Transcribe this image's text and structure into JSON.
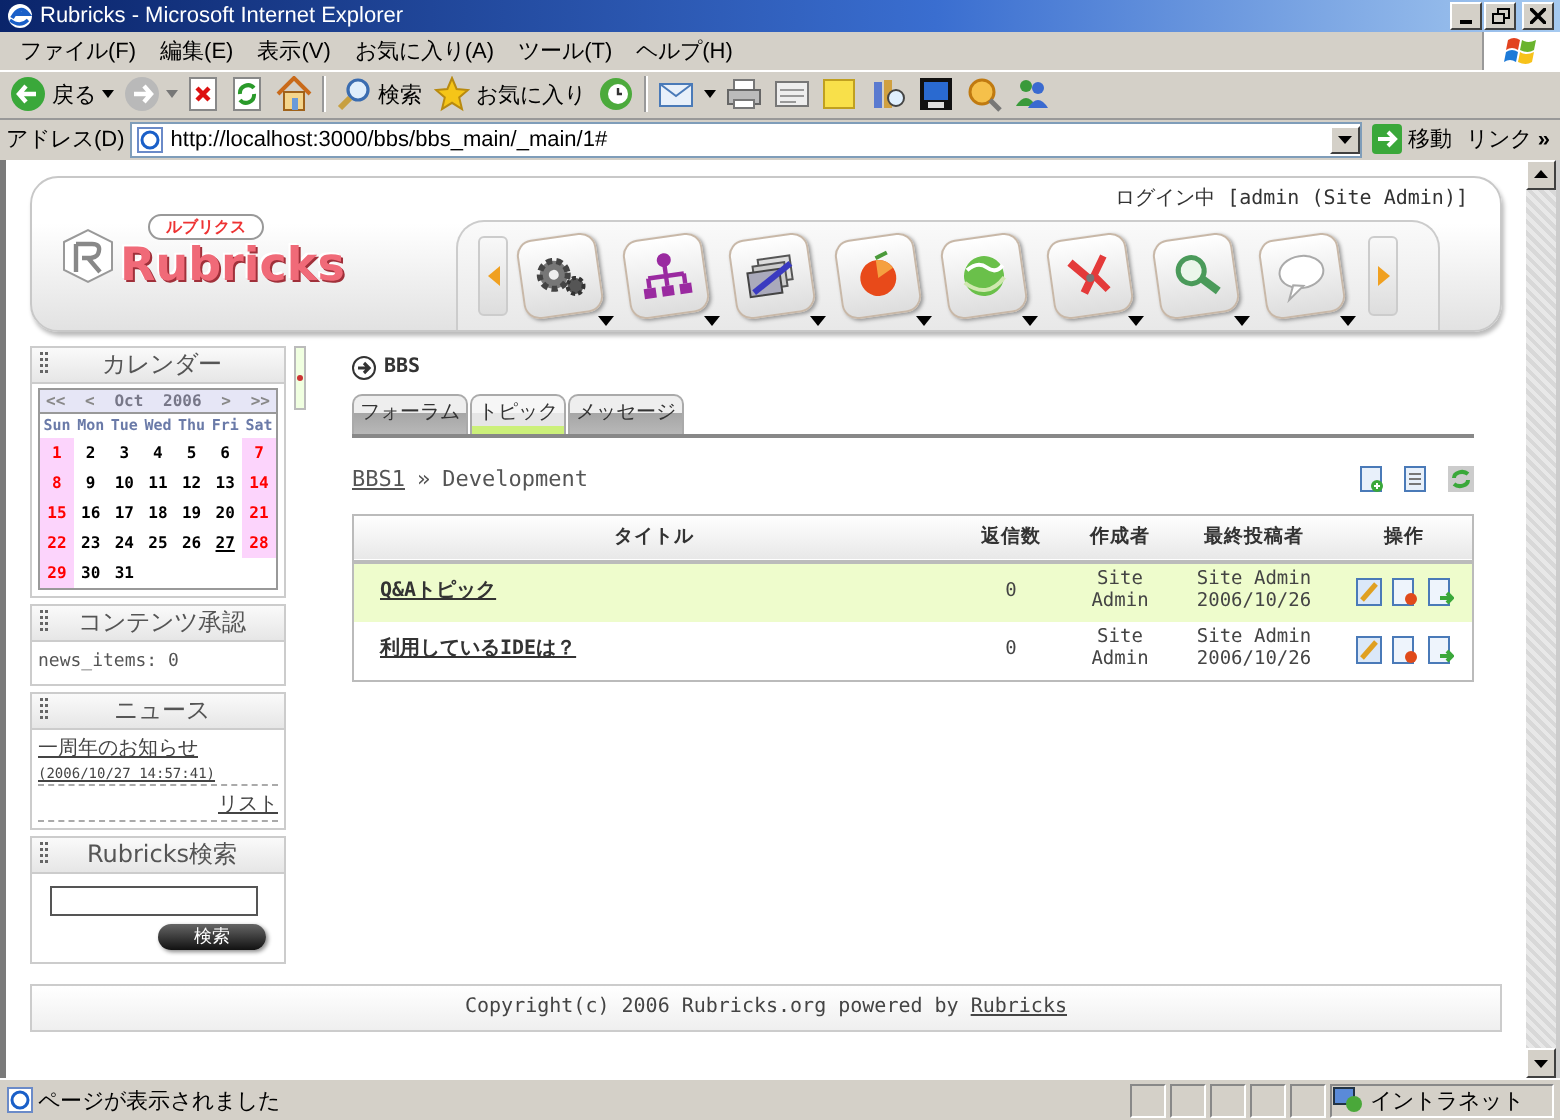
{
  "window": {
    "title": "Rubricks - Microsoft Internet Explorer"
  },
  "menu": [
    "ファイル(F)",
    "編集(E)",
    "表示(V)",
    "お気に入り(A)",
    "ツール(T)",
    "ヘルプ(H)"
  ],
  "toolbar": {
    "back": "戻る",
    "search": "検索",
    "favorites": "お気に入り"
  },
  "address": {
    "label": "アドレス(D)",
    "url": "http://localhost:3000/bbs/bbs_main/_main/1#",
    "go": "移動",
    "links": "リンク",
    "links_more": "»"
  },
  "header": {
    "logo_kana": "ルブリクス",
    "logo": "Rubricks",
    "login": "ログイン中 [admin (Site Admin)]"
  },
  "calendar": {
    "title": "カレンダー",
    "nav": [
      "<<",
      "<",
      "Oct",
      "2006",
      ">",
      ">>"
    ],
    "weekdays": [
      {
        "label": "Sun",
        "weekend": true
      },
      {
        "label": "Mon",
        "weekend": false
      },
      {
        "label": "Tue",
        "weekend": false
      },
      {
        "label": "Wed",
        "weekend": false
      },
      {
        "label": "Thu",
        "weekend": false
      },
      {
        "label": "Fri",
        "weekend": false
      },
      {
        "label": "Sat",
        "weekend": true
      }
    ],
    "weeks": [
      [
        {
          "day": "1",
          "link": false
        },
        {
          "day": "2",
          "link": false
        },
        {
          "day": "3",
          "link": false
        },
        {
          "day": "4",
          "link": false
        },
        {
          "day": "5",
          "link": false
        },
        {
          "day": "6",
          "link": false
        },
        {
          "day": "7",
          "link": false
        }
      ],
      [
        {
          "day": "8",
          "link": false
        },
        {
          "day": "9",
          "link": false
        },
        {
          "day": "10",
          "link": false
        },
        {
          "day": "11",
          "link": false
        },
        {
          "day": "12",
          "link": false
        },
        {
          "day": "13",
          "link": false
        },
        {
          "day": "14",
          "link": false
        }
      ],
      [
        {
          "day": "15",
          "link": false
        },
        {
          "day": "16",
          "link": false
        },
        {
          "day": "17",
          "link": false
        },
        {
          "day": "18",
          "link": false
        },
        {
          "day": "19",
          "link": false
        },
        {
          "day": "20",
          "link": false
        },
        {
          "day": "21",
          "link": false
        }
      ],
      [
        {
          "day": "22",
          "link": false
        },
        {
          "day": "23",
          "link": false
        },
        {
          "day": "24",
          "link": false
        },
        {
          "day": "25",
          "link": false
        },
        {
          "day": "26",
          "link": false
        },
        {
          "day": "27",
          "link": true
        },
        {
          "day": "28",
          "link": false
        }
      ],
      [
        {
          "day": "29",
          "link": false
        },
        {
          "day": "30",
          "link": false
        },
        {
          "day": "31",
          "link": false
        }
      ]
    ]
  },
  "approval": {
    "title": "コンテンツ承認",
    "text": "news_items: 0"
  },
  "news": {
    "title": "ニュース",
    "items": [
      {
        "title": "一周年のお知らせ",
        "date": "(2006/10/27 14:57:41)"
      }
    ],
    "more": "リスト"
  },
  "site_search": {
    "title": "Rubricks検索",
    "button": "検索"
  },
  "main": {
    "heading": "BBS",
    "tabs": [
      {
        "label": "フォーラム",
        "selected": false
      },
      {
        "label": "トピック",
        "selected": true
      },
      {
        "label": "メッセージ",
        "selected": false
      }
    ],
    "breadcrumb": {
      "link": "BBS1",
      "separator": "»",
      "current": "Development"
    },
    "columns": [
      "タイトル",
      "返信数",
      "作成者",
      "最終投稿者",
      "操作"
    ],
    "rows": [
      {
        "title": "Q&Aトピック",
        "replies": "0",
        "author": "Site Admin",
        "last_poster": "Site Admin",
        "last_date": "2006/10/26",
        "selected": true
      },
      {
        "title": "利用しているIDEは？",
        "replies": "0",
        "author": "Site Admin",
        "last_poster": "Site Admin",
        "last_date": "2006/10/26",
        "selected": false
      }
    ]
  },
  "footer": {
    "text": "Copyright(c) 2006 Rubricks.org powered by",
    "link": "Rubricks"
  },
  "status_bar": {
    "text": "ページが表示されました",
    "zone": "イントラネット"
  }
}
